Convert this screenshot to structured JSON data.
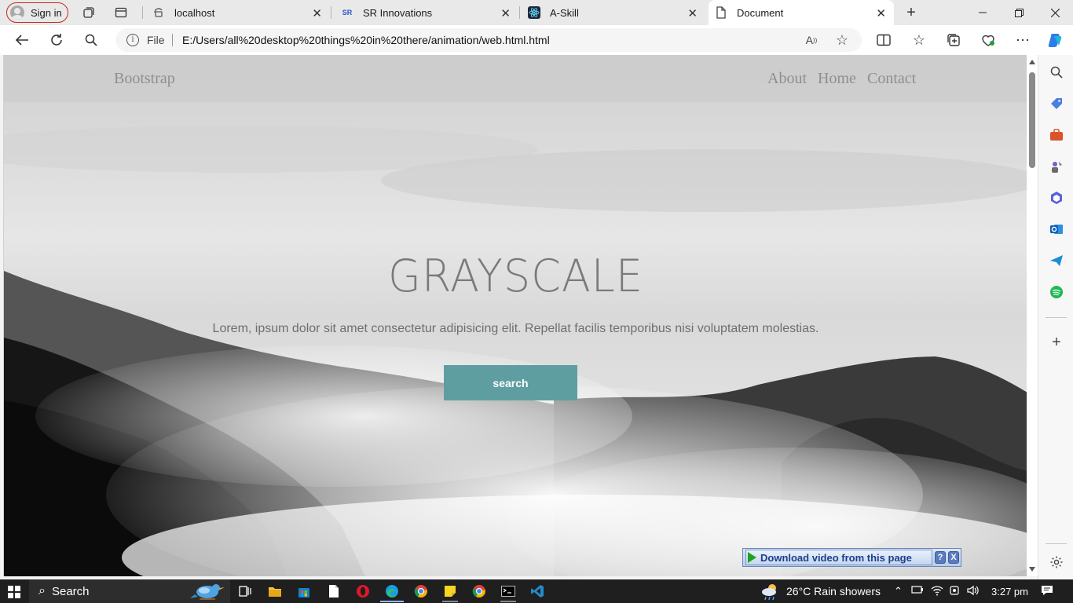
{
  "browser": {
    "signin_label": "Sign in",
    "tabs": [
      {
        "title": "localhost"
      },
      {
        "title": "SR Innovations"
      },
      {
        "title": "A-Skill"
      },
      {
        "title": "Document"
      }
    ],
    "new_tab_symbol": "+",
    "address": {
      "scheme_label": "File",
      "url": "E:/Users/all%20desktop%20things%20in%20there/animation/web.html.html"
    }
  },
  "page": {
    "brand": "Bootstrap",
    "nav_links": [
      "About",
      "Home",
      "Contact"
    ],
    "hero_title": "GRAYSCALE",
    "hero_subtitle": "Lorem, ipsum dolor sit amet consectetur adipisicing elit. Repellat facilis temporibus nisi voluptatem molestias.",
    "search_button": "search"
  },
  "extension_bar": {
    "download_label": "Download video from this page",
    "help_label": "?",
    "close_label": "X"
  },
  "taskbar": {
    "search_label": "Search",
    "weather": "26°C  Rain showers",
    "time": "3:27 pm"
  },
  "colors": {
    "accent_button": "#5f9ea0",
    "signin_border": "#c42b1c",
    "taskbar": "#1f1f1f"
  }
}
